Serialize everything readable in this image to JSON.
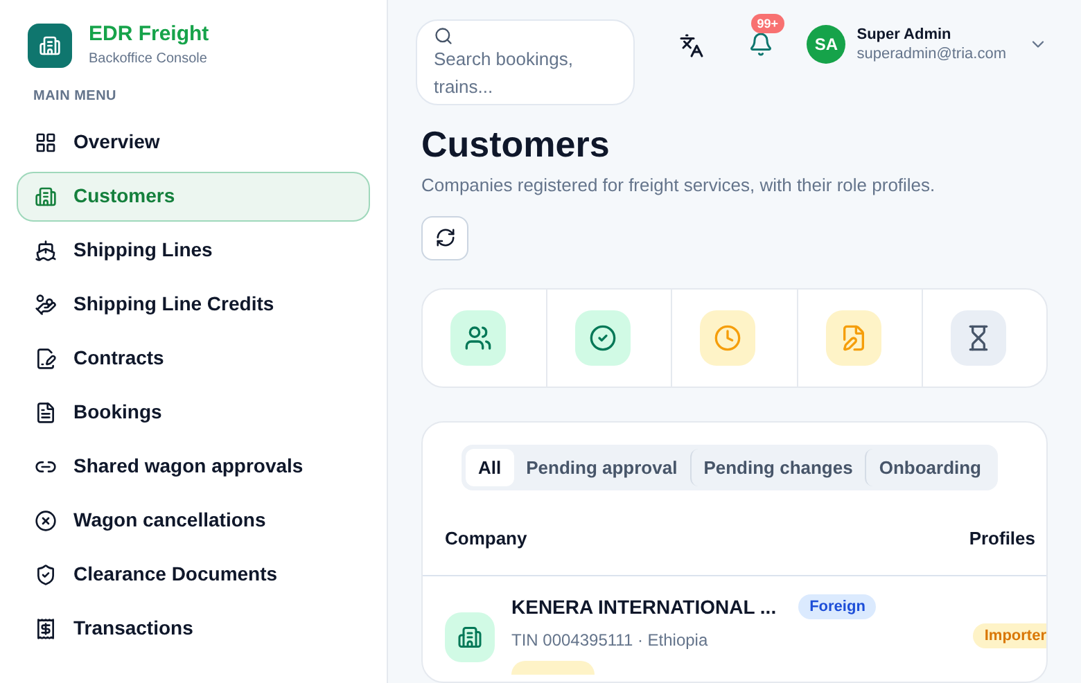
{
  "brand": {
    "name": "EDR Freight",
    "subtitle": "Backoffice Console"
  },
  "sidebar": {
    "section": "MAIN MENU",
    "items": [
      {
        "label": "Overview",
        "selected": false
      },
      {
        "label": "Customers",
        "selected": true
      },
      {
        "label": "Shipping Lines",
        "selected": false
      },
      {
        "label": "Shipping Line Credits",
        "selected": false
      },
      {
        "label": "Contracts",
        "selected": false
      },
      {
        "label": "Bookings",
        "selected": false
      },
      {
        "label": "Shared wagon approvals",
        "selected": false
      },
      {
        "label": "Wagon cancellations",
        "selected": false
      },
      {
        "label": "Clearance Documents",
        "selected": false
      },
      {
        "label": "Transactions",
        "selected": false
      }
    ]
  },
  "header": {
    "search": {
      "placeholder": "Search bookings, trains..."
    },
    "notifications": "99+",
    "user": {
      "initials": "SA",
      "name": "Super Admin",
      "email": "superadmin@tria.com"
    }
  },
  "page": {
    "title": "Customers",
    "subtitle": "Companies registered for freight services, with their role profiles."
  },
  "stats": [
    {
      "color": "#d1fae5"
    },
    {
      "color": "#d1fae5"
    },
    {
      "color": "#fef3c7"
    },
    {
      "color": "#fef3c7"
    },
    {
      "color": "#e9eef5"
    }
  ],
  "tabs": [
    {
      "label": "All",
      "selected": true
    },
    {
      "label": "Pending approval",
      "selected": false
    },
    {
      "label": "Pending changes",
      "selected": false
    },
    {
      "label": "Onboarding",
      "selected": false
    }
  ],
  "table": {
    "columns": [
      "Company",
      "Profiles"
    ],
    "rows": [
      {
        "name": "KENERA INTERNATIONAL ...",
        "origin": "Foreign",
        "details": "TIN 0004395111 · Ethiopia",
        "profile": "Importer"
      }
    ]
  }
}
